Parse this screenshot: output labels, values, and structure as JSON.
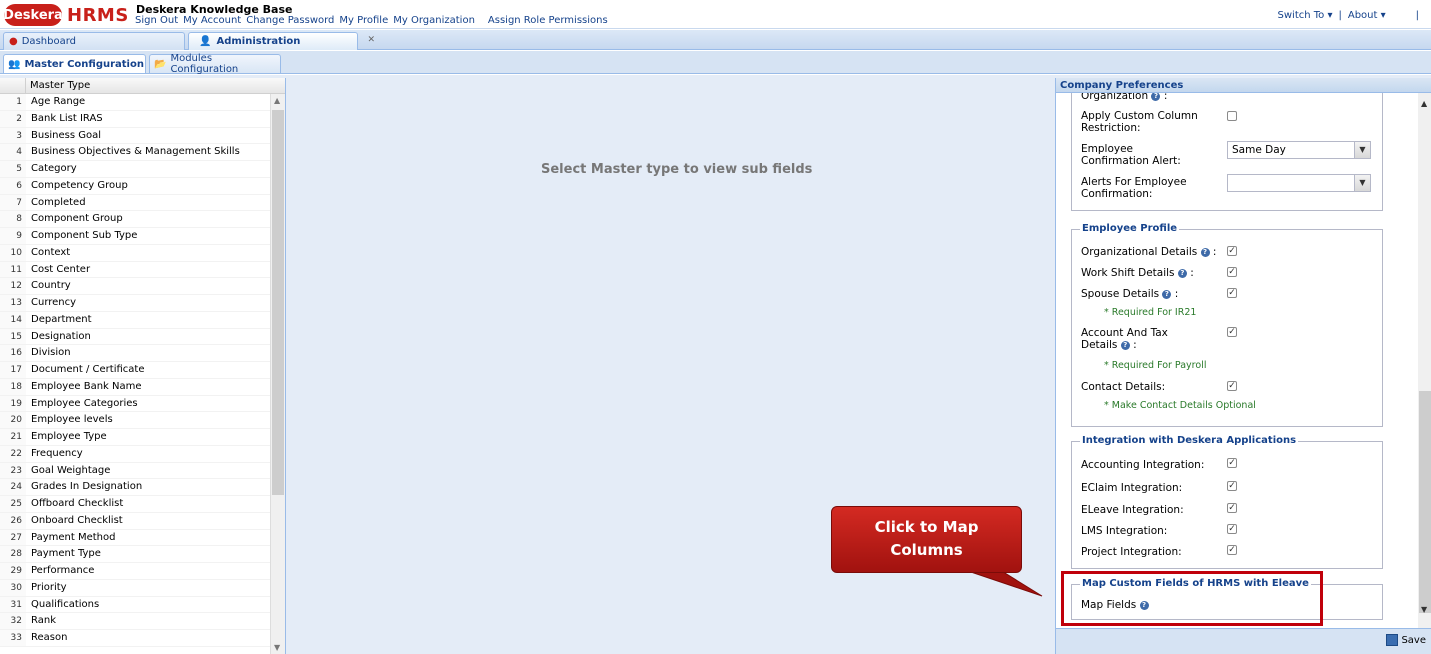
{
  "header": {
    "logo_text": "Deskera",
    "product": "HRMS",
    "kb_title": "Deskera Knowledge Base",
    "links": [
      "Sign Out",
      "My Account",
      "Change Password",
      "My Profile",
      "My Organization",
      "Assign Role Permissions"
    ],
    "right_links": [
      "Switch To ▾",
      "|",
      "About ▾",
      "|"
    ]
  },
  "tabs": [
    {
      "label": "Dashboard"
    },
    {
      "label": "Administration"
    }
  ],
  "subtabs": [
    {
      "label": "Master Configuration"
    },
    {
      "label": "Modules Configuration"
    }
  ],
  "grid": {
    "header": "Master Type",
    "rows": [
      "Age Range",
      "Bank List IRAS",
      "Business Goal",
      "Business Objectives & Management Skills",
      "Category",
      "Competency Group",
      "Completed",
      "Component Group",
      "Component Sub Type",
      "Context",
      "Cost Center",
      "Country",
      "Currency",
      "Department",
      "Designation",
      "Division",
      "Document / Certificate",
      "Employee Bank Name",
      "Employee Categories",
      "Employee levels",
      "Employee Type",
      "Frequency",
      "Goal Weightage",
      "Grades In Designation",
      "Offboard Checklist",
      "Onboard Checklist",
      "Payment Method",
      "Payment Type",
      "Performance",
      "Priority",
      "Qualifications",
      "Rank",
      "Reason"
    ],
    "row_numbers": [
      "1",
      "2",
      "3",
      "4",
      "5",
      "6",
      "7",
      "8",
      "9",
      "10",
      "11",
      "12",
      "13",
      "14",
      "15",
      "16",
      "17",
      "18",
      "19",
      "20",
      "21",
      "22",
      "23",
      "24",
      "25",
      "26",
      "27",
      "28",
      "29",
      "30",
      "31",
      "32",
      "33"
    ]
  },
  "middle": {
    "message": "Select Master type to view sub fields"
  },
  "callout": {
    "line1": "Click to Map",
    "line2": "Columns"
  },
  "panel": {
    "title": "Company Preferences",
    "top_cut_label": "Organization",
    "apply_custom": "Apply Custom Column Restriction:",
    "emp_confirm_alert": "Employee Confirmation Alert:",
    "emp_confirm_alert_value": "Same Day",
    "alerts_for_emp": "Alerts For Employee Confirmation:",
    "alerts_for_emp_value": "",
    "employee_profile": {
      "legend": "Employee Profile",
      "organizational": "Organizational Details",
      "work_shift": "Work Shift Details",
      "spouse": "Spouse Details",
      "spouse_note": "* Required For IR21",
      "account_tax_1": "Account And Tax",
      "account_tax_2": "Details",
      "account_note": "* Required For Payroll",
      "contact": "Contact Details:",
      "contact_note": "* Make Contact Details Optional",
      "colon": ":"
    },
    "integration": {
      "legend": "Integration with Deskera Applications",
      "accounting": "Accounting Integration:",
      "eclaim": "EClaim Integration:",
      "eleave": "ELeave Integration:",
      "lms": "LMS Integration:",
      "project": "Project Integration:"
    },
    "map": {
      "legend": "Map Custom Fields of HRMS with Eleave",
      "link": "Map Fields"
    },
    "save": "Save"
  }
}
